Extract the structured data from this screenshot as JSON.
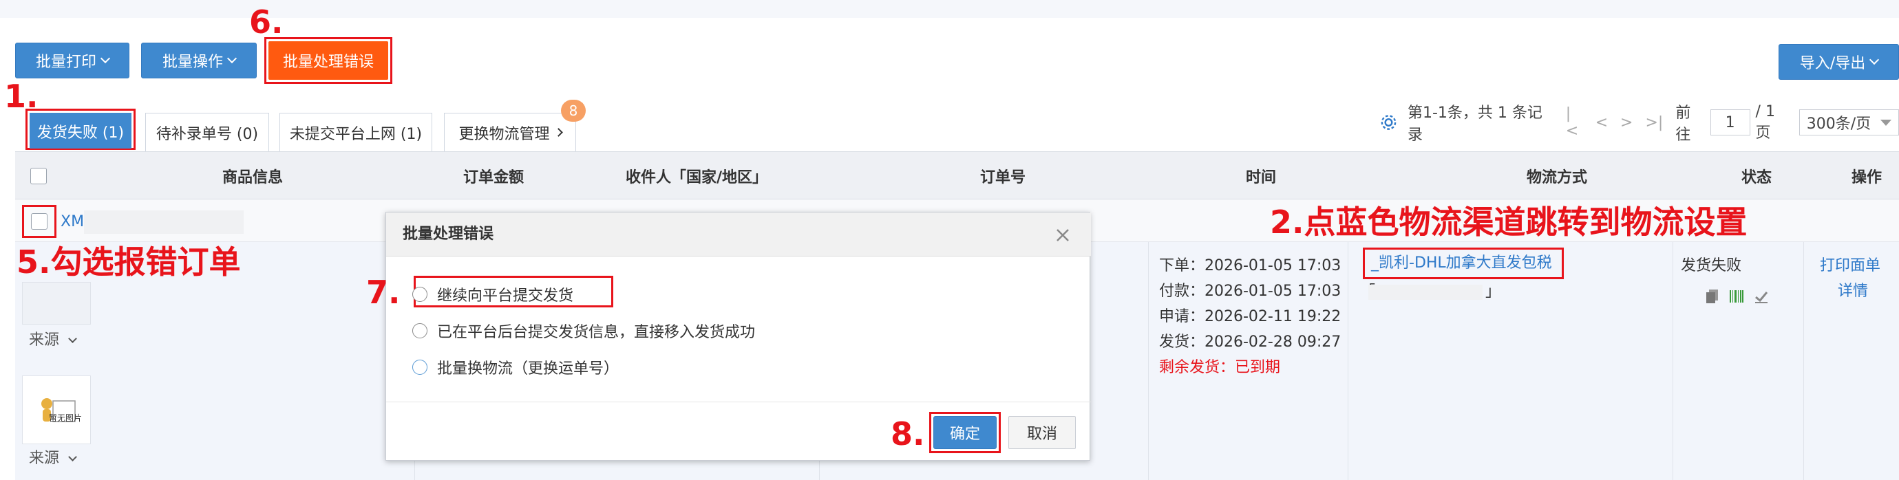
{
  "toolbar": {
    "batch_print": "批量打印",
    "batch_ops": "批量操作",
    "batch_handle_errors": "批量处理错误",
    "import_export": "导入/导出"
  },
  "tabs": [
    {
      "label": "发货失败 (1)"
    },
    {
      "label": "待补录单号 (0)"
    },
    {
      "label": "未提交平台上网 (1)"
    },
    {
      "label": "更换物流管理",
      "badge": "8"
    }
  ],
  "pagination": {
    "summary": "第1-1条，共 1 条记录",
    "goto_label": "前往",
    "page_value": "1",
    "total_pages": "/ 1 页",
    "page_size": "300条/页"
  },
  "table": {
    "headers": [
      "商品信息",
      "订单金额",
      "收件人「国家/地区」",
      "订单号",
      "时间",
      "物流方式",
      "状态",
      "操作"
    ]
  },
  "order": {
    "sku_prefix": "XM",
    "source_label": "来源",
    "no_image_label": "暂无图片",
    "times": [
      "下单：2026-01-05 17:03",
      "付款：2026-01-05 17:03",
      "申请：2026-02-11 19:22",
      "发货：2026-02-28 09:27"
    ],
    "remaining": "剩余发货：已到期",
    "logistics_link": "_凯利-DHL加拿大直发包税",
    "logistics_sub_open": "「",
    "logistics_sub_close": "」",
    "status": "发货失败",
    "op_print": "打印面单",
    "op_detail": "详情"
  },
  "modal": {
    "title": "批量处理错误",
    "options": [
      "继续向平台提交发货",
      "已在平台后台提交发货信息，直接移入发货成功",
      "批量换物流（更换运单号）"
    ],
    "confirm": "确定",
    "cancel": "取消"
  },
  "annotations": {
    "a1": "1.",
    "a2": "2.点蓝色物流渠道跳转到物流设置",
    "a5": "5.勾选报错订单",
    "a6": "6.",
    "a7": "7.",
    "a8": "8."
  },
  "colors": {
    "primary": "#3f89cf",
    "orange": "#ff5a10",
    "annotation_red": "#e8141b",
    "link": "#2e79c9"
  }
}
